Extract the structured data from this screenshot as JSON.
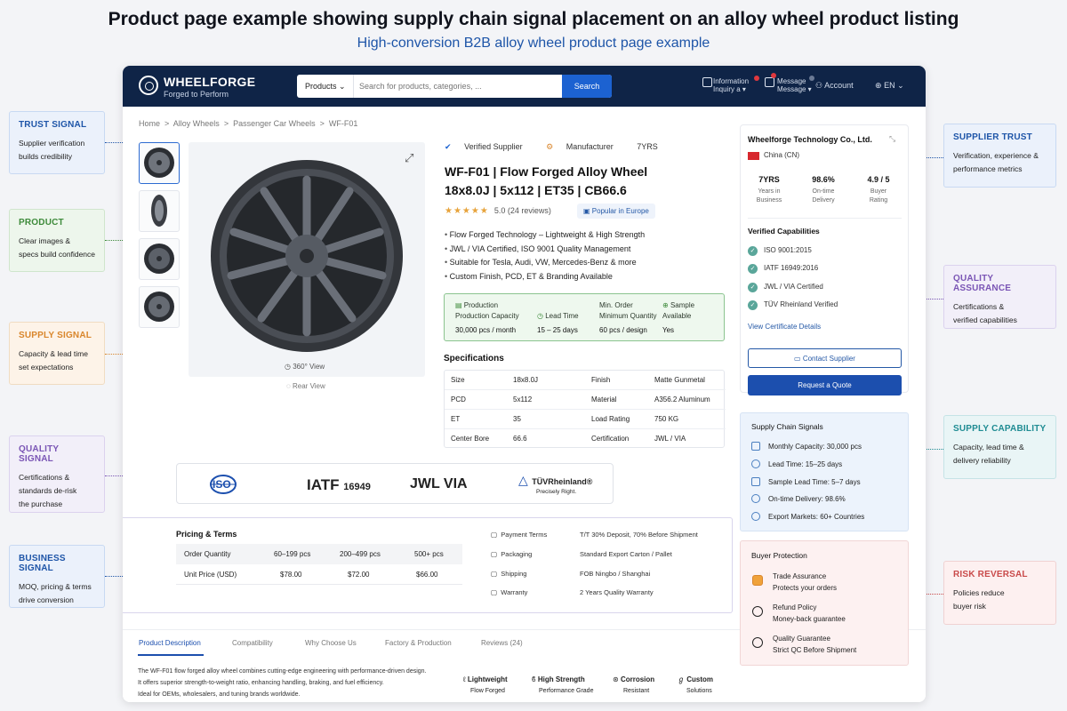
{
  "title": "Product page example showing supply chain signal placement on an alloy wheel product listing",
  "subtitle": "High-conversion B2B alloy wheel product page example",
  "header": {
    "brand": "WHEELFORGE",
    "tagline": "Forged to Perform",
    "search_category": "Products",
    "search_placeholder": "Search for products, categories, ...",
    "search_button": "Search",
    "nav_item_1": "Information",
    "nav_item_1b": "Inquiry a ▾",
    "nav_item_2": "Message",
    "nav_item_2b": "Message ▾",
    "account": "Account",
    "language": "EN"
  },
  "breadcrumb": [
    "Home",
    "Alloy Wheels",
    "Passenger Car Wheels",
    "WF-F01"
  ],
  "gallery": {
    "view360": "360° View",
    "view360_sub": "Rear View"
  },
  "product": {
    "badge_verified": "Verified Supplier",
    "badge_manufacturer": "Manufacturer",
    "badge_years": "7YRS",
    "title_line1": "WF-F01 | Flow Forged Alloy Wheel",
    "title_line2": "18x8.0J | 5x112 | ET35 | CB66.6",
    "stars": "★★★★★",
    "rating": "5.0 (24 reviews)",
    "popular": "Popular in Europe",
    "features": [
      "Flow Forged Technology – Lightweight & High Strength",
      "JWL / VIA Certified, ISO 9001 Quality Management",
      "Suitable for Tesla, Audi, VW, Mercedes-Benz & more",
      "Custom Finish, PCD, ET & Branding Available"
    ]
  },
  "supply_box": {
    "cap_l1": "Production",
    "cap_l2": "Production Capacity",
    "cap_v": "30,000 pcs / month",
    "lead_l": "Lead Time",
    "lead_v": "15 – 25 days",
    "moq_l1": "Min. Order",
    "moq_l2": "Minimum Quantity",
    "moq_v": "60 pcs / design",
    "sample_l1": "Sample",
    "sample_l2": "Available",
    "sample_v": "Yes"
  },
  "specs": {
    "heading": "Specifications",
    "rows": [
      [
        "Size",
        "18x8.0J",
        "Finish",
        "Matte Gunmetal"
      ],
      [
        "PCD",
        "5x112",
        "Material",
        "A356.2 Aluminum"
      ],
      [
        "ET",
        "35",
        "Load Rating",
        "750 KG"
      ],
      [
        "Center Bore",
        "66.6",
        "Certification",
        "JWL / VIA"
      ]
    ]
  },
  "supplier": {
    "name": "Wheelforge Technology Co., Ltd.",
    "country": "China (CN)",
    "stats": [
      {
        "value": "7YRS",
        "label1": "Years in",
        "label2": "Business"
      },
      {
        "value": "98.6%",
        "label1": "On-time",
        "label2": "Delivery"
      },
      {
        "value": "4.9 / 5",
        "label1": "Buyer",
        "label2": "Rating"
      }
    ],
    "caps_heading": "Verified Capabilities",
    "certs": [
      "ISO 9001:2015",
      "IATF 16949:2016",
      "JWL / VIA Certified",
      "TÜV Rheinland Verified"
    ],
    "cert_link": "View Certificate Details",
    "contact": "Contact Supplier",
    "quote": "Request a Quote"
  },
  "logos": {
    "iso": "ISO",
    "iatf": "IATF",
    "iatf_num": "16949",
    "jwl": "JWL VIA",
    "tuv": "TÜVRheinland®",
    "tuv_sub": "Precisely Right."
  },
  "pricing": {
    "heading": "Pricing & Terms",
    "col_label": "Order Quantity",
    "tiers": [
      "60–199 pcs",
      "200–499 pcs",
      "500+ pcs"
    ],
    "price_label": "Unit Price (USD)",
    "prices": [
      "$78.00",
      "$72.00",
      "$66.00"
    ]
  },
  "terms": [
    [
      "Payment Terms",
      "T/T 30% Deposit, 70% Before Shipment"
    ],
    [
      "Packaging",
      "Standard Export Carton / Pallet"
    ],
    [
      "Shipping",
      "FOB Ningbo / Shanghai"
    ],
    [
      "Warranty",
      "2 Years Quality Warranty"
    ]
  ],
  "tabs": [
    "Product Description",
    "Compatibility",
    "Why Choose Us",
    "Factory & Production",
    "Reviews (24)"
  ],
  "description": [
    "The WF-F01 flow forged alloy wheel combines cutting-edge engineering with performance-driven design.",
    "It offers superior strength-to-weight ratio, enhancing handling, braking, and fuel efficiency.",
    "Ideal for OEMs, wholesalers, and tuning brands worldwide."
  ],
  "features_bottom": [
    [
      "Lightweight",
      "Flow Forged"
    ],
    [
      "High Strength",
      "Performance Grade"
    ],
    [
      "Corrosion",
      "Resistant"
    ],
    [
      "Custom",
      "Solutions"
    ]
  ],
  "supply_chain": {
    "heading": "Supply Chain Signals",
    "items": [
      "Monthly Capacity: 30,000 pcs",
      "Lead Time: 15–25 days",
      "Sample Lead Time: 5–7 days",
      "On-time Delivery: 98.6%",
      "Export Markets: 60+ Countries"
    ]
  },
  "buyer_protection": {
    "heading": "Buyer Protection",
    "items": [
      [
        "Trade Assurance",
        "Protects your orders"
      ],
      [
        "Refund Policy",
        "Money-back guarantee"
      ],
      [
        "Quality Guarantee",
        "Strict QC Before Shipment"
      ]
    ]
  },
  "callouts_left": [
    {
      "title": "TRUST SIGNAL",
      "l1": "Supplier verification",
      "l2": "builds credibility",
      "l3": ""
    },
    {
      "title": "PRODUCT",
      "l1": "Clear images &",
      "l2": "specs build confidence",
      "l3": ""
    },
    {
      "title": "SUPPLY SIGNAL",
      "l1": "Capacity & lead time",
      "l2": "set expectations",
      "l3": ""
    },
    {
      "title": "QUALITY SIGNAL",
      "l1": "Certifications &",
      "l2": "standards de-risk",
      "l3": "the purchase"
    },
    {
      "title": "BUSINESS SIGNAL",
      "l1": "MOQ, pricing & terms",
      "l2": "drive conversion",
      "l3": ""
    }
  ],
  "callouts_right": [
    {
      "title": "SUPPLIER TRUST",
      "l1": "Verification, experience &",
      "l2": "performance metrics"
    },
    {
      "title": "QUALITY ASSURANCE",
      "l1": "Certifications &",
      "l2": "verified capabilities"
    },
    {
      "title": "SUPPLY CAPABILITY",
      "l1": "Capacity, lead time &",
      "l2": "delivery reliability"
    },
    {
      "title": "RISK REVERSAL",
      "l1": "Policies reduce",
      "l2": "buyer risk"
    }
  ],
  "colors": {
    "navy": "#0f2447",
    "accent_blue": "#1c62d1",
    "trust": "#1e55a8",
    "product": "#3d8a3a",
    "supply": "#d9862c",
    "quality": "#7a55b5",
    "business": "#1e55a8",
    "capability": "#1f8c93",
    "risk": "#c94a4a"
  }
}
